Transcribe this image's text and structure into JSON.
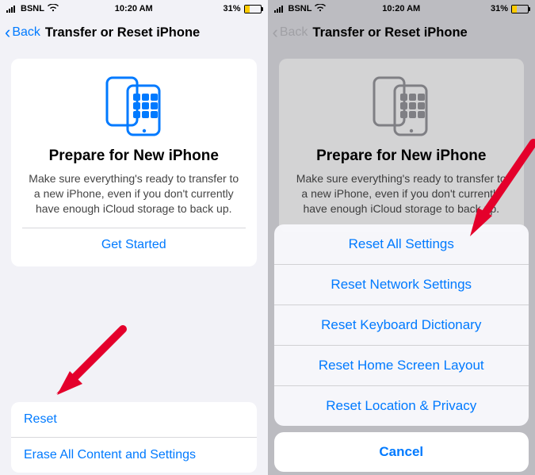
{
  "status": {
    "carrier": "BSNL",
    "time": "10:20 AM",
    "battery_pct": "31%"
  },
  "nav": {
    "back_label": "Back",
    "title": "Transfer or Reset iPhone"
  },
  "card": {
    "heading": "Prepare for New iPhone",
    "body": "Make sure everything's ready to transfer to a new iPhone, even if you don't currently have enough iCloud storage to back up.",
    "cta": "Get Started"
  },
  "list": {
    "reset": "Reset",
    "erase": "Erase All Content and Settings"
  },
  "sheet": {
    "reset_all": "Reset All Settings",
    "reset_network": "Reset Network Settings",
    "reset_keyboard": "Reset Keyboard Dictionary",
    "reset_home": "Reset Home Screen Layout",
    "reset_location": "Reset Location & Privacy",
    "cancel": "Cancel"
  },
  "colors": {
    "ios_blue": "#007aff",
    "arrow_red": "#e4002b"
  }
}
